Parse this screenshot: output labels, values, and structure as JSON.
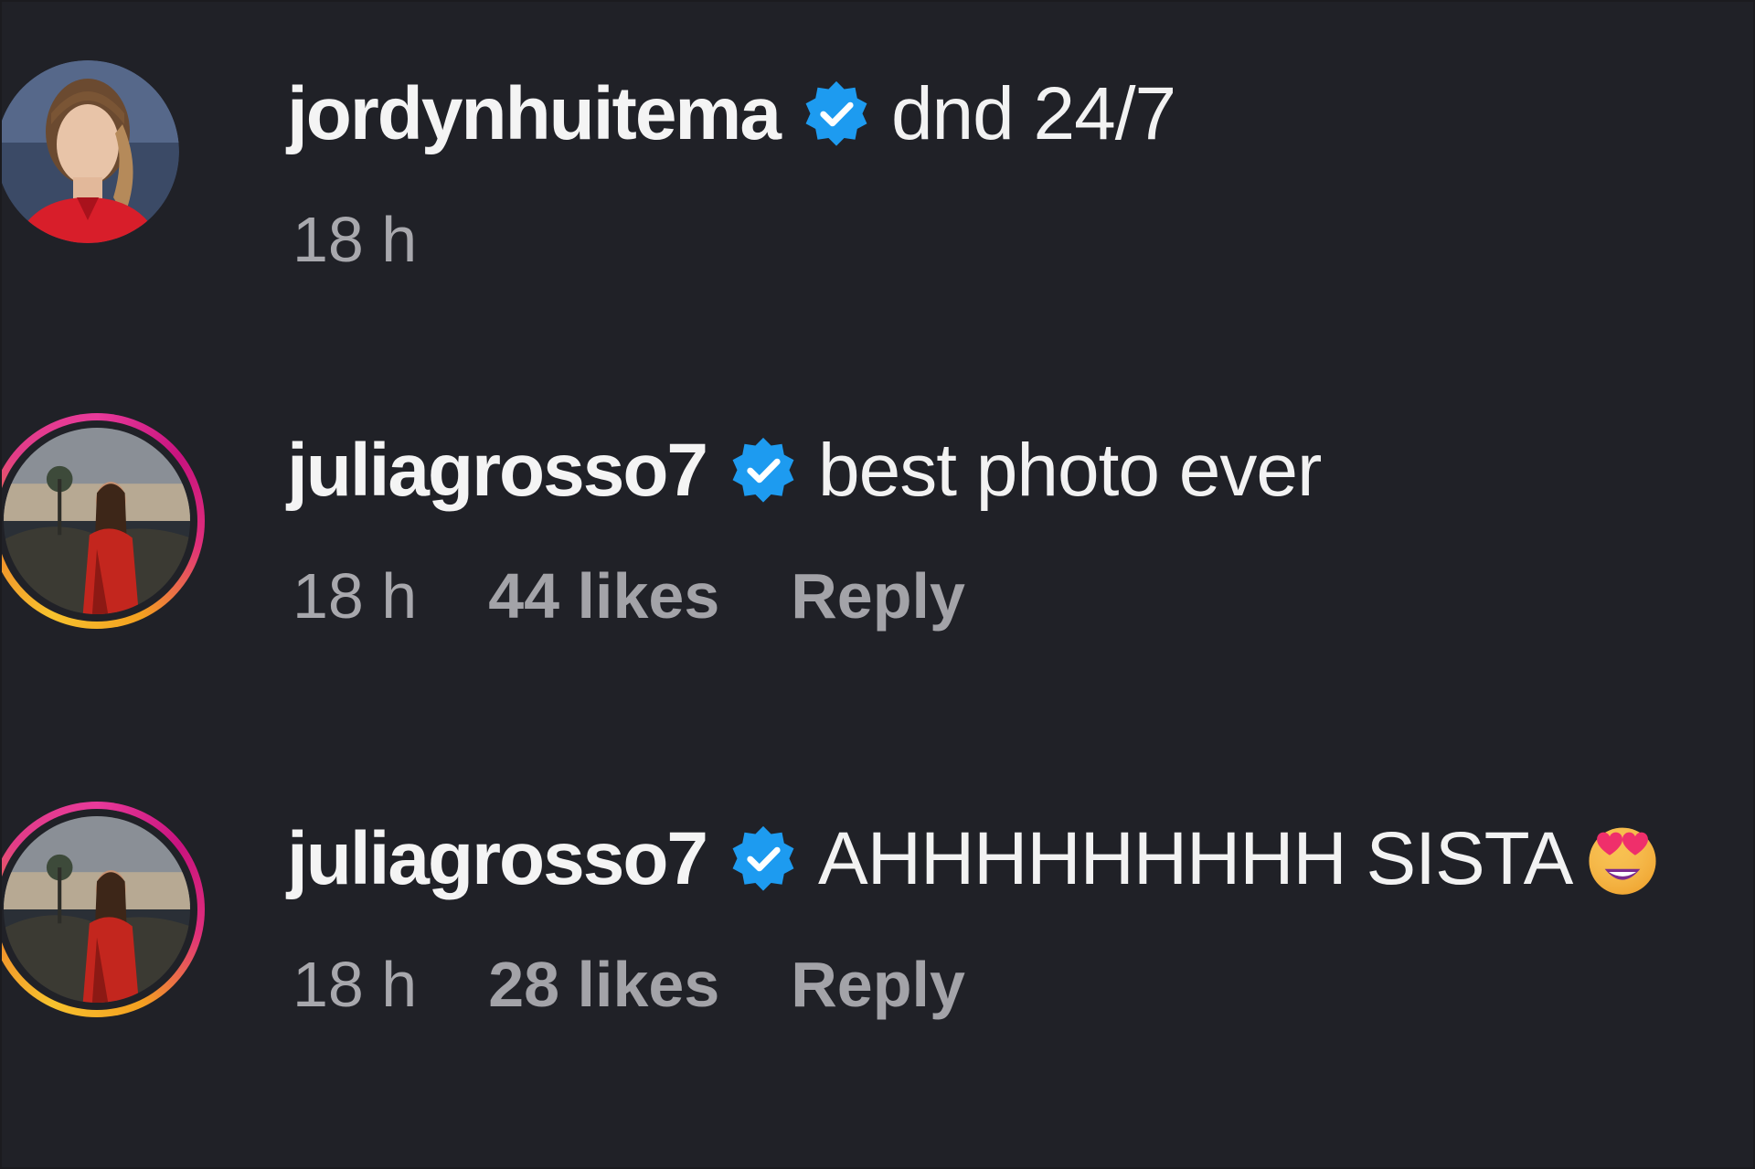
{
  "comments": [
    {
      "username": "jordynhuitema",
      "verified": true,
      "text": "dnd 24/7",
      "time": "18 h",
      "avatar": {
        "story_ring": false
      }
    },
    {
      "username": "juliagrosso7",
      "verified": true,
      "text": "best photo ever",
      "time": "18 h",
      "likes": "44 likes",
      "reply_label": "Reply",
      "avatar": {
        "story_ring": true
      }
    },
    {
      "username": "juliagrosso7",
      "verified": true,
      "text": "AHHHHHHHHH SISTA",
      "emoji": "star-struck-emoji",
      "time": "18 h",
      "likes": "28 likes",
      "reply_label": "Reply",
      "avatar": {
        "story_ring": true
      }
    }
  ],
  "colors": {
    "background": "#202127",
    "verified_badge": "#1d9bf0",
    "username": "#f4f4f4",
    "meta": "#a8a8ad"
  }
}
